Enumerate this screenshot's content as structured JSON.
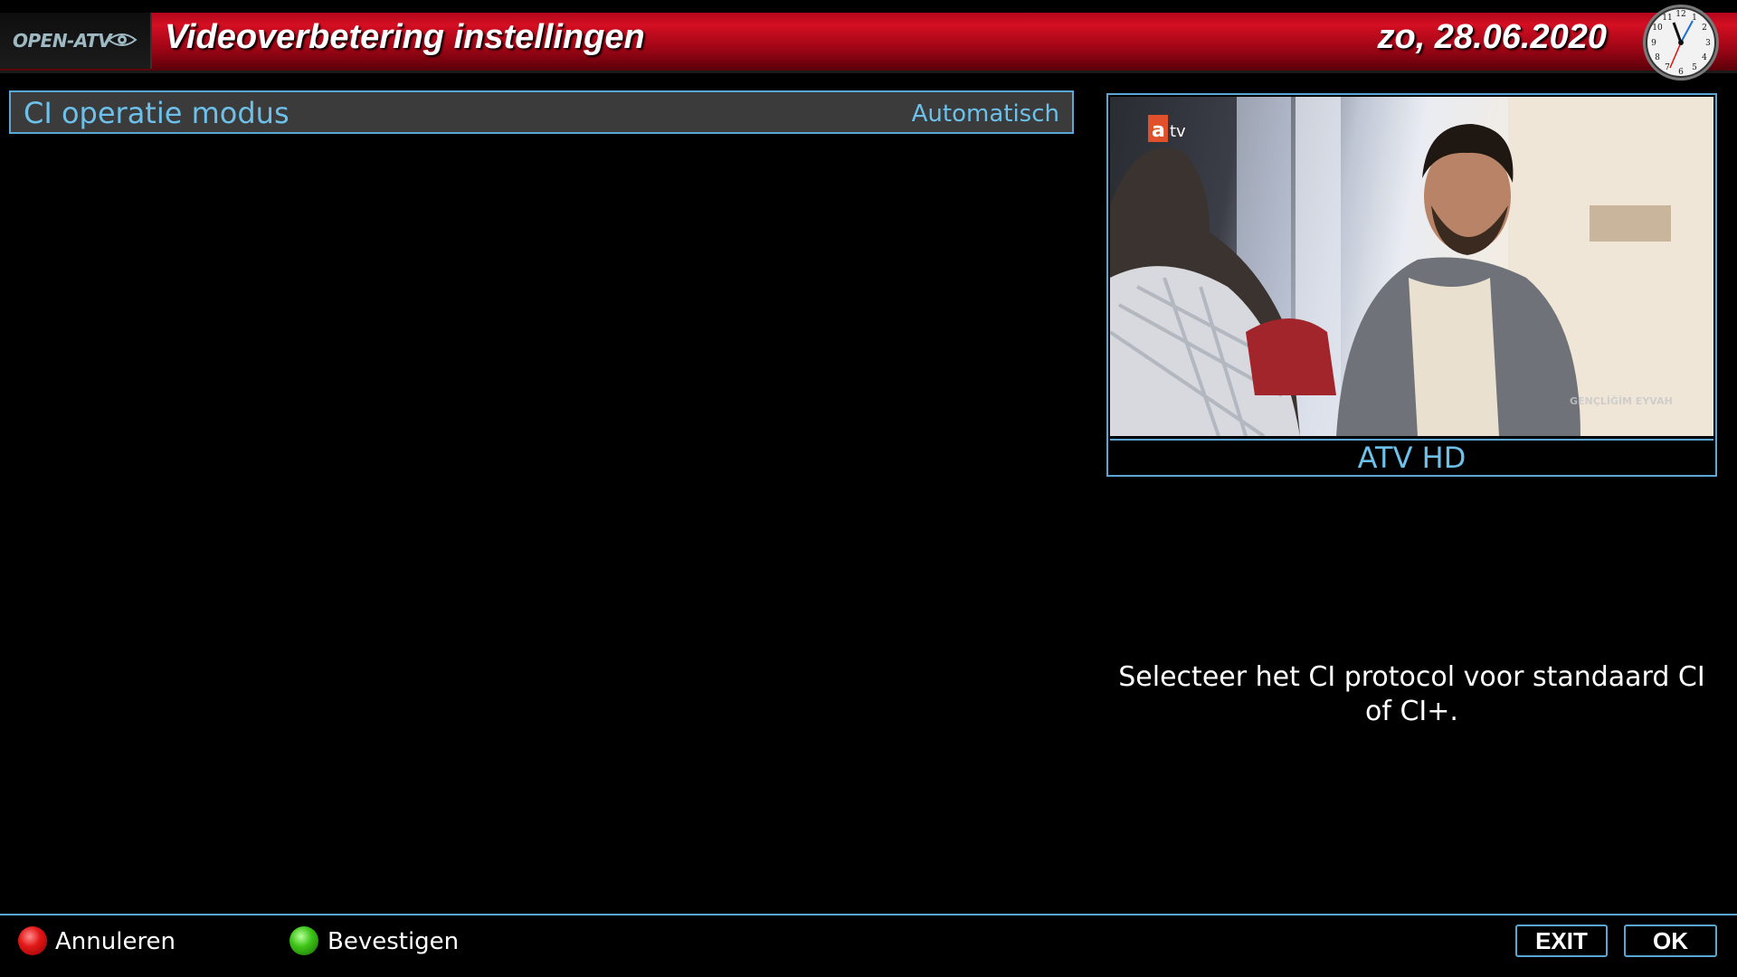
{
  "header": {
    "logo_text": "OPEN-ATV",
    "title": "Videoverbetering instellingen",
    "date": "zo, 28.06.2020"
  },
  "menu": {
    "items": [
      {
        "label": "CI operatie modus",
        "value": "Automatisch"
      }
    ]
  },
  "preview": {
    "channel_logo": "atv",
    "watermark": "GENÇLİĞİM EYVAH",
    "channel_name": "ATV HD"
  },
  "description": "Selecteer het CI protocol voor standaard CI of CI+.",
  "footer": {
    "red_label": "Annuleren",
    "green_label": "Bevestigen",
    "exit_label": "EXIT",
    "ok_label": "OK"
  },
  "colors": {
    "header_red": "#d40f22",
    "accent_blue": "#5aa7d6",
    "text_blue": "#6cc0ea"
  }
}
